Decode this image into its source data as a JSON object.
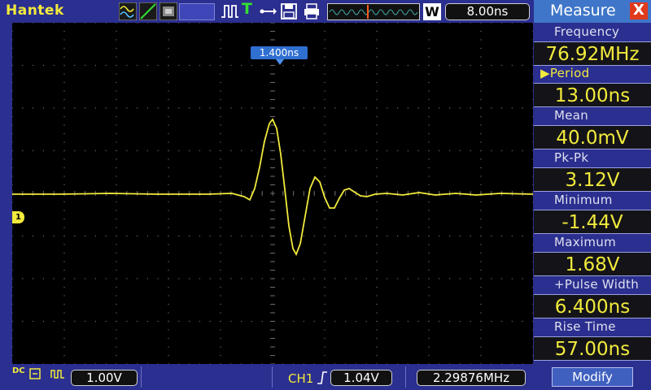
{
  "topbar": {
    "brand": "Hantek",
    "trigger_mode": "T",
    "memory_mode": "W",
    "timebase": "8.00ns"
  },
  "screen": {
    "trigger_position": "1.400ns",
    "ch1_marker": "1",
    "trace_color": "#f2ea3c",
    "grid_color": "#6a6a6a"
  },
  "bottombar": {
    "coupling": "DC",
    "ch1_scale": "1.00V",
    "trigger_source": "CH1",
    "trigger_level": "1.04V",
    "trigger_frequency": "2.29876MHz"
  },
  "measure": {
    "title": "Measure",
    "close": "X",
    "modify": "Modify",
    "items": [
      {
        "label": "Frequency",
        "value": "76.92MHz"
      },
      {
        "label": "▶Period",
        "value": "13.00ns"
      },
      {
        "label": "Mean",
        "value": "40.0mV"
      },
      {
        "label": "Pk-Pk",
        "value": "3.12V"
      },
      {
        "label": "Minimum",
        "value": "-1.44V"
      },
      {
        "label": "Maximum",
        "value": "1.68V"
      },
      {
        "label": "+Pulse Width",
        "value": "6.400ns"
      },
      {
        "label": "Rise Time",
        "value": "57.00ns"
      }
    ]
  }
}
